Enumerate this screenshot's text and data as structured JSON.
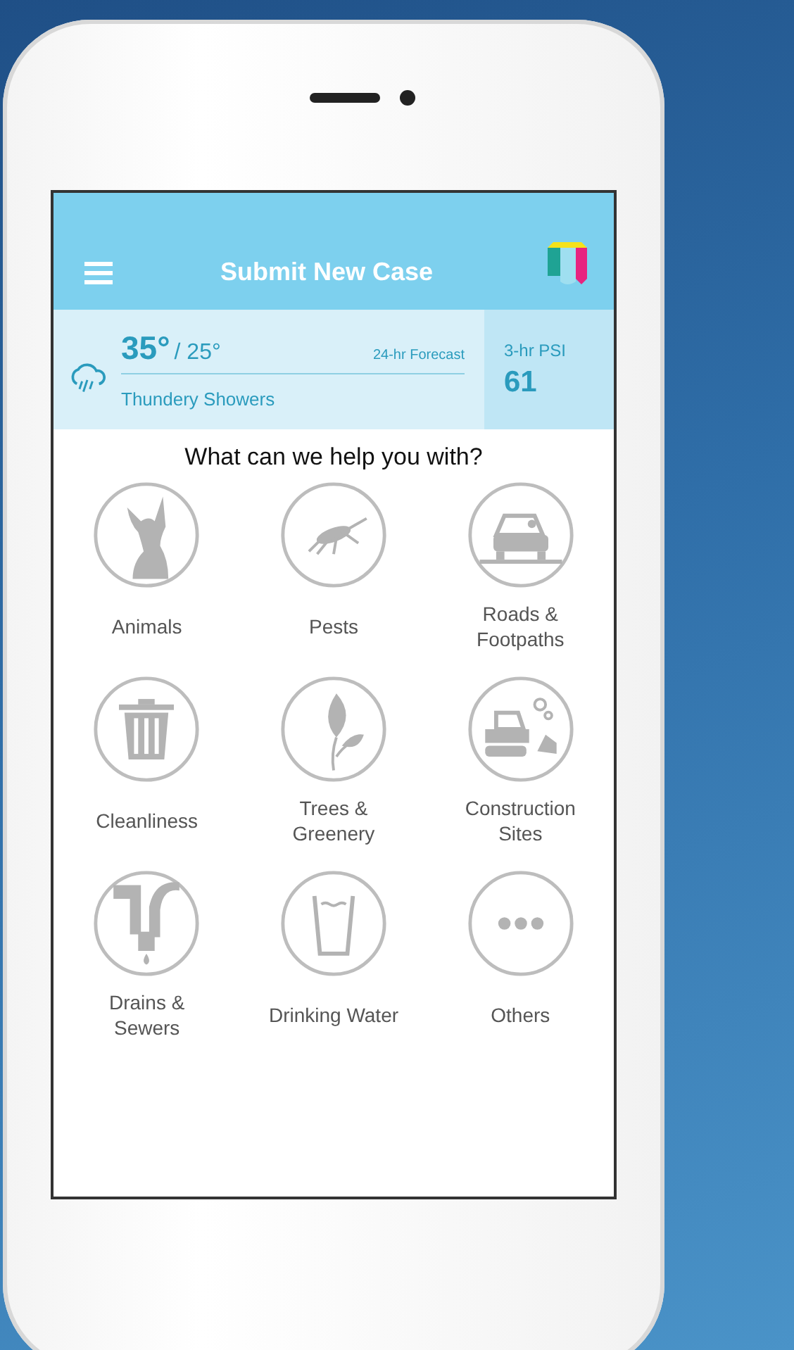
{
  "header": {
    "title": "Submit New Case"
  },
  "weather": {
    "high": "35°",
    "low": "/ 25°",
    "forecast_label": "24-hr Forecast",
    "condition": "Thundery Showers",
    "psi_label": "3-hr PSI",
    "psi_value": "61"
  },
  "prompt": "What can we help you with?",
  "categories": [
    {
      "label": "Animals",
      "kind": "animal"
    },
    {
      "label": "Pests",
      "kind": "mosquito"
    },
    {
      "label": "Roads & Footpaths",
      "kind": "car"
    },
    {
      "label": "Cleanliness",
      "kind": "bin"
    },
    {
      "label": "Trees & Greenery",
      "kind": "leaf"
    },
    {
      "label": "Construction Sites",
      "kind": "excavator"
    },
    {
      "label": "Drains & Sewers",
      "kind": "pipe"
    },
    {
      "label": "Drinking Water",
      "kind": "glass"
    },
    {
      "label": "Others",
      "kind": "dots"
    }
  ]
}
